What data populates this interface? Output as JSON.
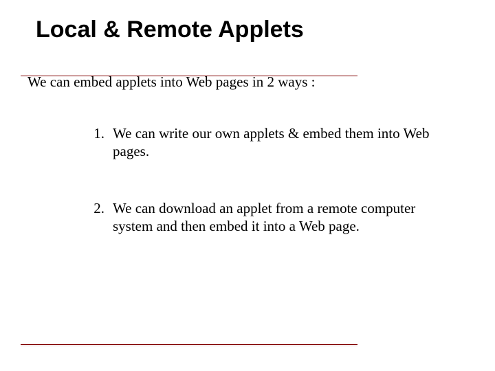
{
  "title": "Local & Remote Applets",
  "intro": "We can embed applets into Web pages in 2 ways :",
  "items": [
    {
      "num": "1.",
      "text": "We can write our own applets & embed them into Web pages."
    },
    {
      "num": "2.",
      "text": "We can download an applet from a remote computer system and then embed it into a Web page."
    }
  ],
  "colors": {
    "accent": "#800000"
  }
}
